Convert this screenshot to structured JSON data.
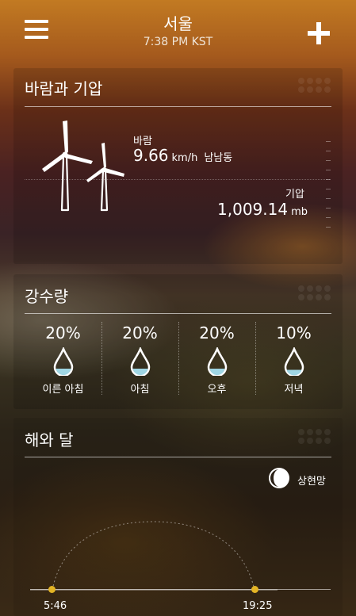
{
  "header": {
    "city": "서울",
    "time": "7:38 PM KST",
    "menu_icon": "hamburger-menu-icon",
    "add_icon": "plus-icon"
  },
  "wind_pressure": {
    "title": "바람과 기압",
    "wind_label": "바람",
    "wind_speed": "9.66",
    "wind_unit": "km/h",
    "wind_direction": "남남동",
    "pressure_label": "기압",
    "pressure_value": "1,009.14",
    "pressure_unit": "mb",
    "icon": "wind-turbine-icon"
  },
  "precipitation": {
    "title": "강수량",
    "periods": [
      {
        "percent": "20%",
        "label": "이른 아침",
        "chance": 20
      },
      {
        "percent": "20%",
        "label": "아침",
        "chance": 20
      },
      {
        "percent": "20%",
        "label": "오후",
        "chance": 20
      },
      {
        "percent": "10%",
        "label": "저녁",
        "chance": 10
      }
    ],
    "icon": "water-drop-icon"
  },
  "sun_moon": {
    "title": "해와 달",
    "moon_phase": "상현망",
    "moon_icon": "moon-phase-icon",
    "sunrise": "5:46",
    "sunset": "19:25"
  },
  "colors": {
    "sun_dot": "#e3b425",
    "text": "#ffffff"
  }
}
